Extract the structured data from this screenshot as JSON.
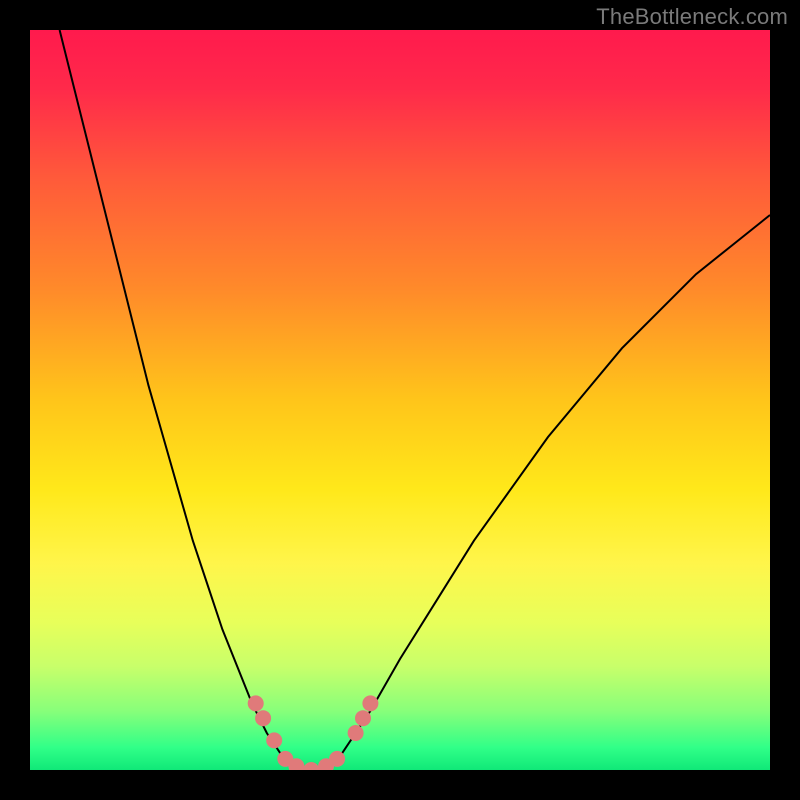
{
  "watermark": "TheBottleneck.com",
  "chart_data": {
    "type": "line",
    "title": "",
    "xlabel": "",
    "ylabel": "",
    "xlim": [
      0,
      100
    ],
    "ylim": [
      0,
      100
    ],
    "background_gradient": [
      {
        "offset": 0.0,
        "color": "#ff1a4d"
      },
      {
        "offset": 0.08,
        "color": "#ff2a4a"
      },
      {
        "offset": 0.2,
        "color": "#ff5a3a"
      },
      {
        "offset": 0.35,
        "color": "#ff8a2a"
      },
      {
        "offset": 0.5,
        "color": "#ffc51a"
      },
      {
        "offset": 0.62,
        "color": "#ffe81a"
      },
      {
        "offset": 0.72,
        "color": "#fff54a"
      },
      {
        "offset": 0.8,
        "color": "#e8ff5a"
      },
      {
        "offset": 0.86,
        "color": "#c8ff6a"
      },
      {
        "offset": 0.92,
        "color": "#88ff7a"
      },
      {
        "offset": 0.97,
        "color": "#30ff88"
      },
      {
        "offset": 1.0,
        "color": "#10e878"
      }
    ],
    "series": [
      {
        "name": "bottleneck-curve",
        "stroke": "#000000",
        "stroke_width": 2,
        "points": [
          {
            "x": 4,
            "y": 100
          },
          {
            "x": 6,
            "y": 92
          },
          {
            "x": 8,
            "y": 84
          },
          {
            "x": 10,
            "y": 76
          },
          {
            "x": 12,
            "y": 68
          },
          {
            "x": 14,
            "y": 60
          },
          {
            "x": 16,
            "y": 52
          },
          {
            "x": 18,
            "y": 45
          },
          {
            "x": 20,
            "y": 38
          },
          {
            "x": 22,
            "y": 31
          },
          {
            "x": 24,
            "y": 25
          },
          {
            "x": 26,
            "y": 19
          },
          {
            "x": 28,
            "y": 14
          },
          {
            "x": 30,
            "y": 9
          },
          {
            "x": 32,
            "y": 5
          },
          {
            "x": 34,
            "y": 2
          },
          {
            "x": 36,
            "y": 0.5
          },
          {
            "x": 38,
            "y": 0
          },
          {
            "x": 40,
            "y": 0.5
          },
          {
            "x": 42,
            "y": 2
          },
          {
            "x": 44,
            "y": 5
          },
          {
            "x": 46,
            "y": 8
          },
          {
            "x": 50,
            "y": 15
          },
          {
            "x": 55,
            "y": 23
          },
          {
            "x": 60,
            "y": 31
          },
          {
            "x": 65,
            "y": 38
          },
          {
            "x": 70,
            "y": 45
          },
          {
            "x": 75,
            "y": 51
          },
          {
            "x": 80,
            "y": 57
          },
          {
            "x": 85,
            "y": 62
          },
          {
            "x": 90,
            "y": 67
          },
          {
            "x": 95,
            "y": 71
          },
          {
            "x": 100,
            "y": 75
          }
        ]
      }
    ],
    "markers": {
      "color": "#e07a7a",
      "points": [
        {
          "x": 30.5,
          "y": 9
        },
        {
          "x": 31.5,
          "y": 7
        },
        {
          "x": 33,
          "y": 4
        },
        {
          "x": 34.5,
          "y": 1.5
        },
        {
          "x": 36,
          "y": 0.5
        },
        {
          "x": 38,
          "y": 0
        },
        {
          "x": 40,
          "y": 0.5
        },
        {
          "x": 41.5,
          "y": 1.5
        },
        {
          "x": 44,
          "y": 5
        },
        {
          "x": 45,
          "y": 7
        },
        {
          "x": 46,
          "y": 9
        }
      ]
    }
  }
}
